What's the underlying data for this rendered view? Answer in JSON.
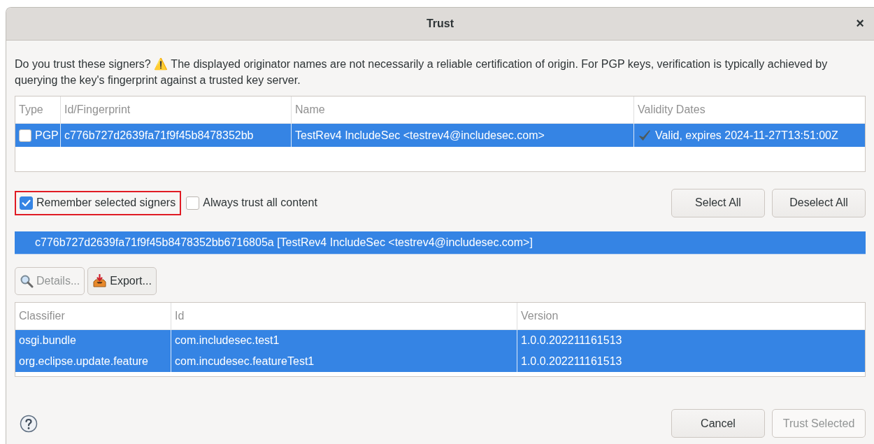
{
  "window": {
    "title": "Trust",
    "close": "×"
  },
  "message": "Do you trust these signers?  ⚠️ The displayed originator names are not necessarily a reliable certification of origin.  For PGP keys, verification is typically achieved by querying the key's fingerprint against a trusted key server.",
  "signers_table": {
    "columns": [
      "Type",
      "Id/Fingerprint",
      "Name",
      "Validity Dates"
    ],
    "rows": [
      {
        "selected": true,
        "checked": false,
        "type": "PGP",
        "fingerprint": "c776b727d2639fa71f9f45b8478352bb",
        "name": "TestRev4 IncludeSec <testrev4@includesec.com>",
        "validity": "Valid, expires 2024-11-27T13:51:00Z",
        "valid": true
      }
    ]
  },
  "options": [
    {
      "label": "Remember selected signers",
      "checked": true,
      "highlighted": true
    },
    {
      "label": "Always trust all content",
      "checked": false,
      "highlighted": false
    }
  ],
  "select_buttons": [
    {
      "label": "Select All",
      "disabled": false
    },
    {
      "label": "Deselect All",
      "disabled": false
    }
  ],
  "selected_signer": "c776b727d2639fa71f9f45b8478352bb6716805a [TestRev4 IncludeSec <testrev4@includesec.com>]",
  "tool_buttons": [
    {
      "kind": "details",
      "label": "Details...",
      "disabled": true
    },
    {
      "kind": "export",
      "label": "Export...",
      "disabled": false
    }
  ],
  "artifacts_table": {
    "columns": [
      "Classifier",
      "Id",
      "Version"
    ],
    "rows": [
      {
        "selected": true,
        "cells": [
          "osgi.bundle",
          "com.includesec.test1",
          "1.0.0.202211161513"
        ]
      },
      {
        "selected": true,
        "cells": [
          "org.eclipse.update.feature",
          "com.incudesec.featureTest1",
          "1.0.0.202211161513"
        ]
      }
    ]
  },
  "footer_buttons": [
    {
      "label": "Cancel",
      "disabled": false
    },
    {
      "label": "Trust Selected",
      "disabled": true
    }
  ]
}
